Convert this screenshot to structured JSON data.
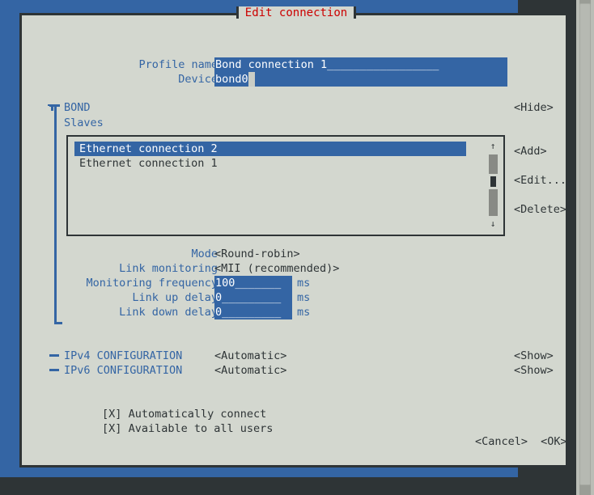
{
  "window": {
    "title": "Edit connection",
    "title_color": "#cc0000",
    "app_background": "#3465a4",
    "dialog_background": "#d3d7cf",
    "border_color": "#2e3436",
    "accent_color": "#3465a4",
    "label_color": "#3465a4",
    "text_color": "#2e3436"
  },
  "fields": {
    "profile_name": {
      "label": "Profile name",
      "value": "Bond connection 1",
      "filler": "_________________"
    },
    "device": {
      "label": "Device",
      "value": "bond0",
      "cursor": " ",
      "filler": "            "
    }
  },
  "bond": {
    "section_title": "BOND",
    "hide_button": "<Hide>",
    "slaves_label": "Slaves",
    "slaves": [
      {
        "name": "Ethernet connection 2",
        "selected": true
      },
      {
        "name": "Ethernet connection 1",
        "selected": false
      }
    ],
    "scrollbar": {
      "up_arrow": "↑",
      "down_arrow": "↓"
    },
    "actions": [
      {
        "label": "<Add>"
      },
      {
        "label": "<Edit...>"
      },
      {
        "label": "<Delete>"
      }
    ],
    "options": [
      {
        "label": "Mode",
        "value": "<Round-robin>",
        "type": "select"
      },
      {
        "label": "Link monitoring",
        "value": "<MII (recommended)>",
        "type": "select"
      },
      {
        "label": "Monitoring frequency",
        "value": "100",
        "filler": "_______",
        "unit": "ms",
        "type": "entry"
      },
      {
        "label": "Link up delay",
        "value": "0",
        "filler": "_________",
        "unit": "ms",
        "type": "entry"
      },
      {
        "label": "Link down delay",
        "value": "0",
        "filler": "_________",
        "unit": "ms",
        "type": "entry"
      }
    ]
  },
  "ip_config": [
    {
      "title": "IPv4 CONFIGURATION",
      "value": "<Automatic>",
      "toggle": "<Show>"
    },
    {
      "title": "IPv6 CONFIGURATION",
      "value": "<Automatic>",
      "toggle": "<Show>"
    }
  ],
  "checkboxes": [
    {
      "mark": "[X]",
      "label": "Automatically connect"
    },
    {
      "mark": "[X]",
      "label": "Available to all users"
    }
  ],
  "bottom_buttons": [
    {
      "label": "<Cancel>"
    },
    {
      "label": "<OK>"
    }
  ]
}
